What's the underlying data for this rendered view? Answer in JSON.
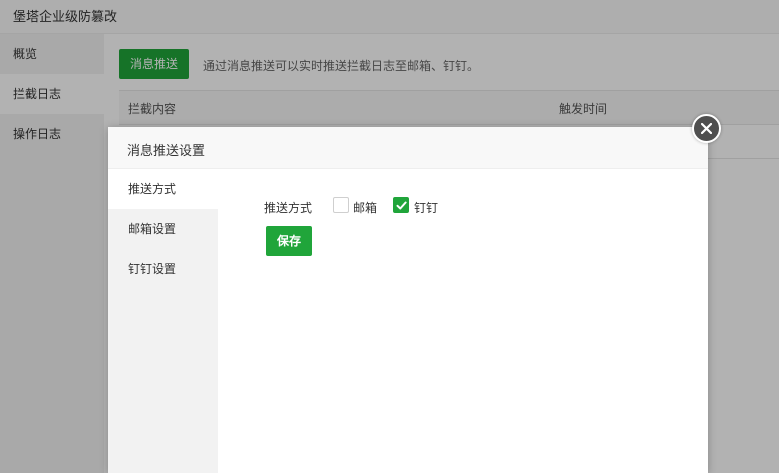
{
  "app": {
    "title": "堡塔企业级防篡改"
  },
  "sidebar": {
    "items": [
      {
        "label": "概览",
        "active": false
      },
      {
        "label": "拦截日志",
        "active": true
      },
      {
        "label": "操作日志",
        "active": false
      }
    ]
  },
  "main": {
    "push_button_label": "消息推送",
    "push_description": "通过消息推送可以实时推送拦截日志至邮箱、钉钉。",
    "table": {
      "columns": [
        "拦截内容",
        "触发时间"
      ]
    }
  },
  "modal": {
    "title": "消息推送设置",
    "nav": [
      {
        "label": "推送方式",
        "active": true
      },
      {
        "label": "邮箱设置",
        "active": false
      },
      {
        "label": "钉钉设置",
        "active": false
      }
    ],
    "push_method": {
      "label": "推送方式",
      "options": [
        {
          "label": "邮箱",
          "checked": false
        },
        {
          "label": "钉钉",
          "checked": true
        }
      ]
    },
    "save_label": "保存"
  },
  "colors": {
    "accent": "#20a53a",
    "overlay": "rgba(0,0,0,0.3)",
    "close_button": "#4f4f4f"
  }
}
